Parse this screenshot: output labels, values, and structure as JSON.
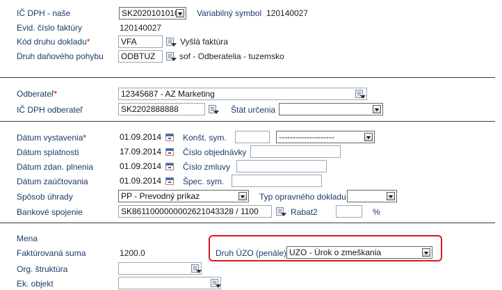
{
  "header": {
    "ic_dph_label": "IČ DPH - naše",
    "ic_dph_value": "SK2020101010",
    "var_symbol_label": "Variabilný symbol",
    "var_symbol_value": "120140027",
    "evid_label": "Evid. číslo faktúry",
    "evid_value": "120140027",
    "kod_label": "Kód druhu dokladu",
    "kod_value": "VFA",
    "kod_desc": "Vyšlá faktúra",
    "druh_label": "Druh daňového pohybu",
    "druh_value": "ODBTUZ",
    "druh_desc": "sof - Odberatelia - tuzemsko"
  },
  "partner": {
    "odberatel_label": "Odberateľ",
    "odberatel_value": "12345687 - AZ Marketing",
    "ic_dph_odb_label": "IČ DPH odberateľ",
    "ic_dph_odb_value": "SK2202888888",
    "stat_label": "Štát určenia",
    "stat_value": ""
  },
  "dates": {
    "vystavenia_label": "Dátum vystavenia",
    "vystavenia_value": "01.09.2014",
    "konst_label": "Konšt. sym.",
    "konst_value": "",
    "konst_select_value": "--------------------",
    "splatnosti_label": "Dátum splatnosti",
    "splatnosti_value": "17.09.2014",
    "objednavky_label": "Číslo objednávky",
    "objednavky_value": "",
    "zdan_label": "Dátum zdan. plnenia",
    "zdan_value": "01.09.2014",
    "zmluvy_label": "Číslo zmluvy",
    "zmluvy_value": "",
    "zauct_label": "Dátum zaúčtovania",
    "zauct_value": "01.09.2014",
    "spec_label": "Špec. sym.",
    "spec_value": "",
    "uhrady_label": "Spôsob úhrady",
    "uhrady_value": "PP - Prevodný príkaz",
    "typ_label": "Typ opravného dokladu",
    "typ_value": "",
    "banka_label": "Bankové spojenie",
    "banka_value": "SK8611000000002621043328 / 1100",
    "rabat_label": "Rabat2",
    "rabat_value": "",
    "rabat_unit": "%"
  },
  "amounts": {
    "mena_label": "Mena",
    "suma_label": "Faktúrovaná suma",
    "suma_value": "1200.0",
    "uzo_label": "Druh ÚZO (penále)",
    "uzo_value": "UZO - Úrok o zmeškania",
    "org_label": "Org. štruktúra",
    "org_value": "",
    "ek_label": "Ek. objekt",
    "ek_value": ""
  },
  "colors": {
    "label": "#1a3a6b",
    "required": "#d00000",
    "highlight": "#d6171f"
  }
}
